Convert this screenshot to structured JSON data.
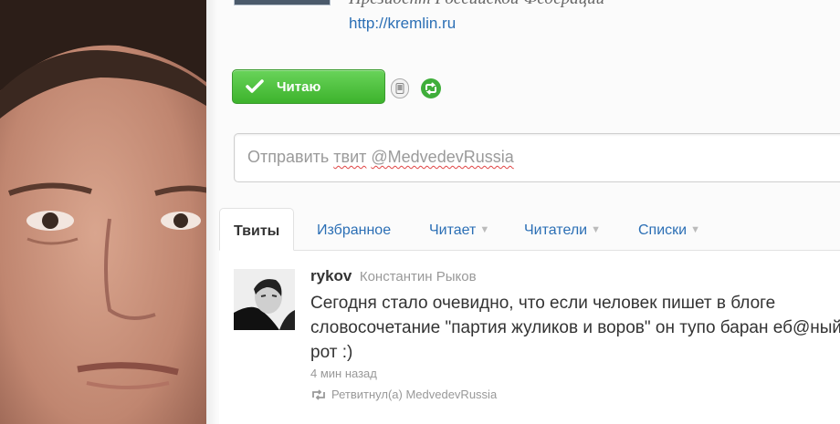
{
  "profile": {
    "bio": "Президент Российской Федерации",
    "url": "http://kremlin.ru"
  },
  "actions": {
    "follow_label": "Читаю"
  },
  "tweet_box": {
    "placeholder_prefix": "Отправить ",
    "placeholder_word": "твит",
    "placeholder_space": " ",
    "placeholder_handle": "@MedvedevRussia"
  },
  "tabs": [
    {
      "label": "Твиты"
    },
    {
      "label": "Избранное"
    },
    {
      "label": "Читает"
    },
    {
      "label": "Читатели"
    },
    {
      "label": "Списки"
    }
  ],
  "tweet": {
    "screen_name": "rykov",
    "full_name": "Константин Рыков",
    "text": "Сегодня стало очевидно, что если человек пишет в блоге словосочетание \"партия жуликов и воров\" он тупо баран еб@ный в рот :)",
    "time": "4 мин назад",
    "retweeted_by": "Ретвитнул(а) MedvedevRussia"
  },
  "colors": {
    "link": "#2b6fb5",
    "follow_button": "#45b934",
    "muted_text": "#999999"
  },
  "icons": [
    "check-icon",
    "device-icon",
    "retweets-icon",
    "caret-down-icon",
    "retweet-icon"
  ]
}
